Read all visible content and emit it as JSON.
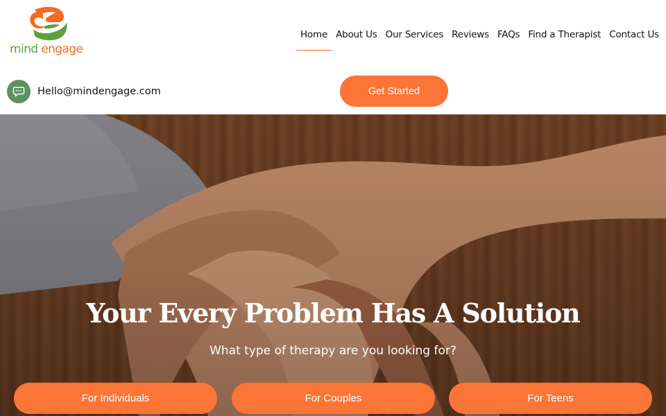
{
  "brand": {
    "logo_text_part1": "mind ",
    "logo_text_part2": "engage",
    "logo_icon": "head-leaf-logo-icon"
  },
  "nav": {
    "items": [
      {
        "label": "Home",
        "active": true
      },
      {
        "label": "About Us"
      },
      {
        "label": "Our Services"
      },
      {
        "label": "Reviews"
      },
      {
        "label": "FAQs"
      },
      {
        "label": "Find a Therapist"
      },
      {
        "label": "Contact Us"
      }
    ]
  },
  "contact": {
    "icon": "chat-bubble-icon",
    "email": "Hello@mindengage.com"
  },
  "header": {
    "cta_label": "Get Started"
  },
  "hero": {
    "title": "Your Every Problem Has A Solution",
    "subtitle": "What type of therapy are you looking for?",
    "buttons": [
      {
        "label": "For Individuals"
      },
      {
        "label": "For Couples"
      },
      {
        "label": "For Teens"
      }
    ]
  },
  "colors": {
    "accent": "#fb7537",
    "brand_green": "#5aa33a",
    "brand_orange": "#f26b21",
    "icon_bg": "#5b9260"
  }
}
